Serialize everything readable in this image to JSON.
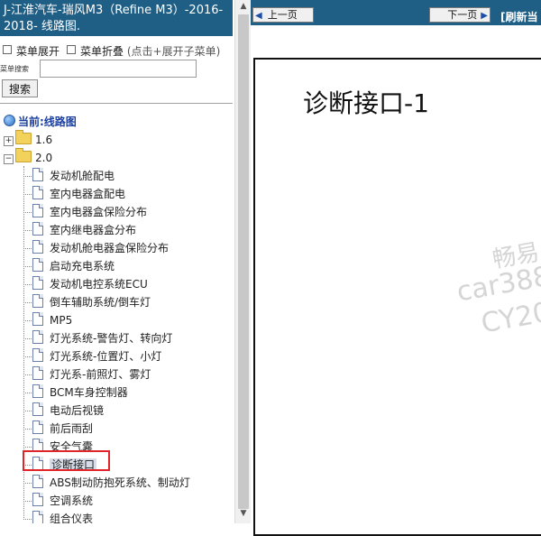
{
  "sidebar": {
    "title": "J-江淮汽车-瑞风M3（Refine M3）-2016-2018- 线路图.",
    "menu_expand": "菜单展开",
    "menu_collapse": "菜单折叠",
    "menu_hint": "(点击+展开子菜单)",
    "search_label": "菜单搜索",
    "search_value": "",
    "search_button": "搜索",
    "tree": {
      "root_label": "当前:线路图",
      "folders": [
        {
          "label": "1.6",
          "expanded": false
        },
        {
          "label": "2.0",
          "expanded": true
        }
      ],
      "items": [
        {
          "label": "发动机舱配电"
        },
        {
          "label": "室内电器盒配电"
        },
        {
          "label": "室内电器盒保险分布"
        },
        {
          "label": "室内继电器盒分布"
        },
        {
          "label": "发动机舱电器盒保险分布"
        },
        {
          "label": "启动充电系统"
        },
        {
          "label": "发动机电控系统ECU"
        },
        {
          "label": "倒车辅助系统/倒车灯"
        },
        {
          "label": "MP5"
        },
        {
          "label": "灯光系统-警告灯、转向灯"
        },
        {
          "label": "灯光系统-位置灯、小灯"
        },
        {
          "label": "灯光系-前照灯、雾灯"
        },
        {
          "label": "BCM车身控制器"
        },
        {
          "label": "电动后视镜"
        },
        {
          "label": "前后雨刮"
        },
        {
          "label": "安全气囊"
        },
        {
          "label": "诊断接口",
          "selected": true
        },
        {
          "label": "ABS制动防抱死系统、制动灯"
        },
        {
          "label": "空调系统"
        },
        {
          "label": "组合仪表"
        }
      ]
    }
  },
  "viewer": {
    "prev_label": "上一页",
    "next_label": "下一页",
    "refresh_label": "[刷新当",
    "page_title": "诊断接口-1",
    "watermark_line1": "畅易",
    "watermark_line2": "car388.",
    "watermark_line3": "CY20"
  },
  "colors": {
    "header_bg": "#1f5f86",
    "highlight_border": "#e0242a",
    "root_label": "#1a3fa0"
  }
}
